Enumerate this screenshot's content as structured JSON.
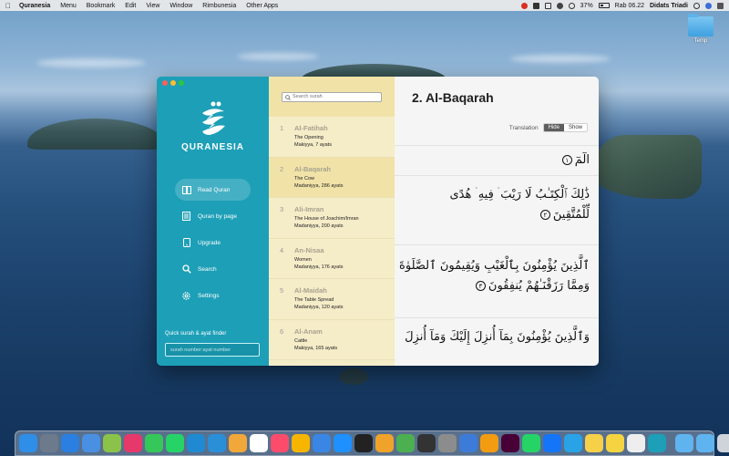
{
  "menubar": {
    "app_name": "Quranesia",
    "menus": [
      "Menu",
      "Bookmark",
      "Edit",
      "View",
      "Window",
      "Rimbunesia",
      "Other Apps"
    ],
    "battery": "37%",
    "clock": "Rab 06.22",
    "user": "Didats Triadi"
  },
  "desktop": {
    "folder_label": "Temp"
  },
  "app": {
    "logo_text": "QURANESIA",
    "nav": [
      {
        "label": "Read Quran",
        "icon": "book-icon",
        "active": true
      },
      {
        "label": "Quran by page",
        "icon": "pages-icon",
        "active": false
      },
      {
        "label": "Upgrade",
        "icon": "upgrade-icon",
        "active": false
      },
      {
        "label": "Search",
        "icon": "search-icon",
        "active": false
      },
      {
        "label": "Settings",
        "icon": "gear-icon",
        "active": false
      }
    ],
    "finder": {
      "label": "Quick surah & ayat finder",
      "placeholder": "surah number:ayat number"
    },
    "search_placeholder": "Search surah",
    "surahs": [
      {
        "number": "1",
        "name": "Al-Fatihah",
        "meaning": "The Opening",
        "meta": "Makiyya, 7 ayats"
      },
      {
        "number": "2",
        "name": "Al-Baqarah",
        "meaning": "The Cow",
        "meta": "Madaniyya, 286 ayats"
      },
      {
        "number": "3",
        "name": "Ali-Imran",
        "meaning": "The House of Joachim/Imran",
        "meta": "Madaniyya, 200 ayats"
      },
      {
        "number": "4",
        "name": "An-Nisaa",
        "meaning": "Women",
        "meta": "Madaniyya, 176 ayats"
      },
      {
        "number": "5",
        "name": "Al-Maidah",
        "meaning": "The Table Spread",
        "meta": "Madaniyya, 120 ayats"
      },
      {
        "number": "6",
        "name": "Al-Anam",
        "meaning": "Cattle",
        "meta": "Makiyya, 165 ayats"
      }
    ],
    "reader": {
      "title": "2. Al-Baqarah",
      "translation_label": "Translation",
      "hide_label": "Hide",
      "show_label": "Show",
      "verses": [
        {
          "lines": [
            "الٓمٓ"
          ],
          "number": "١"
        },
        {
          "lines": [
            "ذَٰلِكَ ٱلْكِتَـٰبُ لَا رَيْبَ ۛ فِيهِ ۛ هُدًى",
            "لِّلْمُتَّقِينَ"
          ],
          "number": "٢"
        },
        {
          "lines": [
            "ٱلَّذِينَ يُؤْمِنُونَ بِٱلْغَيْبِ وَيُقِيمُونَ ٱلصَّلَوٰةَ",
            "وَمِمَّا رَزَقْنَـٰهُمْ يُنفِقُونَ"
          ],
          "number": "٣"
        },
        {
          "lines": [
            "وَٱلَّذِينَ يُؤْمِنُونَ بِمَآ أُنزِلَ إِلَيْكَ وَمَآ أُنزِلَ"
          ],
          "number": ""
        }
      ]
    }
  },
  "dock_icons": [
    "finder-icon",
    "launchpad-icon",
    "safari-icon",
    "mail-icon",
    "preview-icon",
    "slack-icon",
    "messages-icon",
    "whatsapp-icon",
    "vscode-icon",
    "edge-icon",
    "photos-icon",
    "calendar-icon",
    "music-icon",
    "sketch-icon",
    "keynote-icon",
    "appstore-icon",
    "github-icon",
    "sequel-icon",
    "maps-icon",
    "terminal-icon",
    "system-preferences-icon",
    "safari-technology-preview-icon",
    "books-icon",
    "xd-icon",
    "whatsapp-desktop-icon",
    "xcode-icon",
    "telegram-icon",
    "cyberduck-icon",
    "notes-icon",
    "textedit-icon",
    "quranesia-icon",
    "downloads-folder-icon",
    "documents-folder-icon",
    "trash-icon"
  ]
}
